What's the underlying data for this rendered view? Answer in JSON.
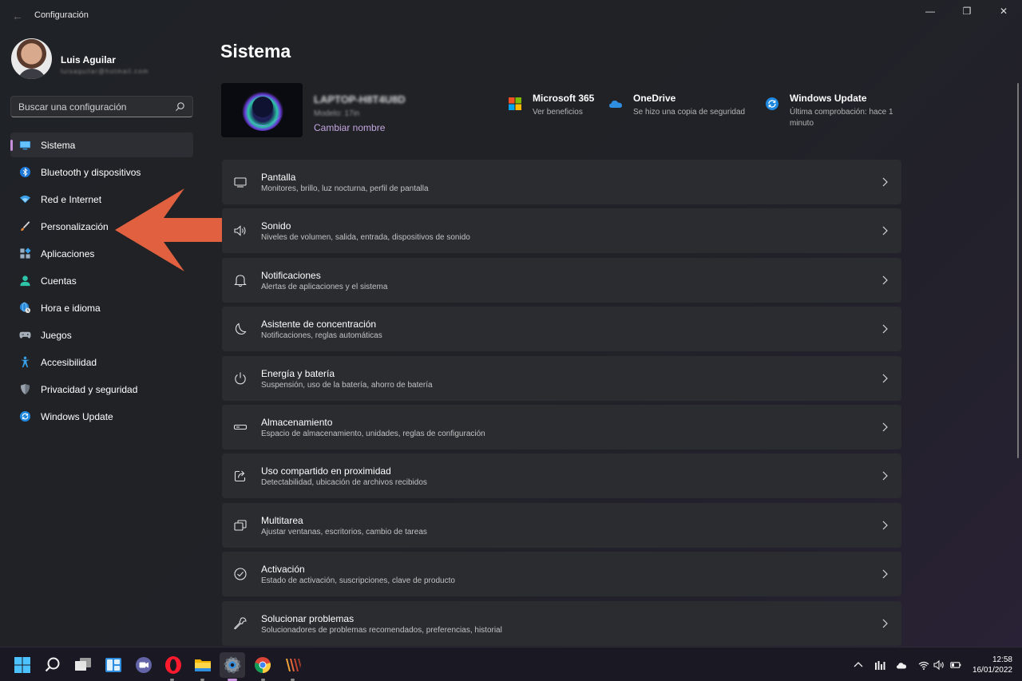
{
  "window": {
    "title": "Configuración",
    "back_glyph": "←",
    "controls": [
      "—",
      "❐",
      "✕"
    ]
  },
  "profile": {
    "name": "Luis Aguilar",
    "email": "luisaguilar@hotmail.com"
  },
  "search": {
    "placeholder": "Buscar una configuración"
  },
  "sidebar": {
    "items": [
      {
        "label": "Sistema",
        "icon": "monitor-icon",
        "active": true
      },
      {
        "label": "Bluetooth y dispositivos",
        "icon": "bluetooth-icon"
      },
      {
        "label": "Red e Internet",
        "icon": "wifi-icon"
      },
      {
        "label": "Personalización",
        "icon": "brush-icon"
      },
      {
        "label": "Aplicaciones",
        "icon": "apps-icon"
      },
      {
        "label": "Cuentas",
        "icon": "person-icon"
      },
      {
        "label": "Hora e idioma",
        "icon": "globe-clock-icon"
      },
      {
        "label": "Juegos",
        "icon": "gamepad-icon"
      },
      {
        "label": "Accesibilidad",
        "icon": "accessibility-icon"
      },
      {
        "label": "Privacidad y seguridad",
        "icon": "shield-icon"
      },
      {
        "label": "Windows Update",
        "icon": "update-icon"
      }
    ]
  },
  "main": {
    "title": "Sistema",
    "device": {
      "name": "LAPTOP-H8T4U8D",
      "model": "Modelo: 17in",
      "rename_label": "Cambiar nombre"
    },
    "quick": [
      {
        "title": "Microsoft 365",
        "sub": "Ver beneficios",
        "icon": "microsoft-logo-icon"
      },
      {
        "title": "OneDrive",
        "sub": "Se hizo una copia de seguridad",
        "icon": "onedrive-cloud-icon"
      },
      {
        "title": "Windows Update",
        "sub_line1": "Última comprobación: hace 1",
        "sub_line2": "minuto",
        "icon": "update-icon"
      }
    ],
    "cards": [
      {
        "title": "Pantalla",
        "sub": "Monitores, brillo, luz nocturna, perfil de pantalla",
        "icon": "display-icon"
      },
      {
        "title": "Sonido",
        "sub": "Niveles de volumen, salida, entrada, dispositivos de sonido",
        "icon": "speaker-icon"
      },
      {
        "title": "Notificaciones",
        "sub": "Alertas de aplicaciones y el sistema",
        "icon": "bell-icon"
      },
      {
        "title": "Asistente de concentración",
        "sub": "Notificaciones, reglas automáticas",
        "icon": "moon-icon"
      },
      {
        "title": "Energía y batería",
        "sub": "Suspensión, uso de la batería, ahorro de batería",
        "icon": "power-icon"
      },
      {
        "title": "Almacenamiento",
        "sub": "Espacio de almacenamiento, unidades, reglas de configuración",
        "icon": "storage-drive-icon"
      },
      {
        "title": "Uso compartido en proximidad",
        "sub": "Detectabilidad, ubicación de archivos recibidos",
        "icon": "share-icon"
      },
      {
        "title": "Multitarea",
        "sub": "Ajustar ventanas, escritorios, cambio de tareas",
        "icon": "multitask-icon"
      },
      {
        "title": "Activación",
        "sub": "Estado de activación, suscripciones, clave de producto",
        "icon": "check-circle-icon"
      },
      {
        "title": "Solucionar problemas",
        "sub": "Solucionadores de problemas recomendados, preferencias, historial",
        "icon": "wrench-icon"
      }
    ]
  },
  "taskbar": {
    "apps": [
      "start-icon",
      "search-icon",
      "task-view-icon",
      "widgets-icon",
      "teams-chat-icon",
      "opera-icon",
      "file-explorer-icon",
      "settings-gear-icon",
      "chrome-icon",
      "winamp-icon"
    ],
    "active_app": "settings-gear-icon",
    "tray": [
      "chevron-up-icon",
      "equalizer-icon",
      "cloud-icon",
      "wifi-icon",
      "volume-icon",
      "battery-icon"
    ],
    "time": "12:58",
    "date": "16/01/2022"
  },
  "colors": {
    "accent": "#c58fd9",
    "link": "#c4a7e0",
    "annotation_arrow": "#e0603f",
    "card_bg": "#2b2c30"
  }
}
